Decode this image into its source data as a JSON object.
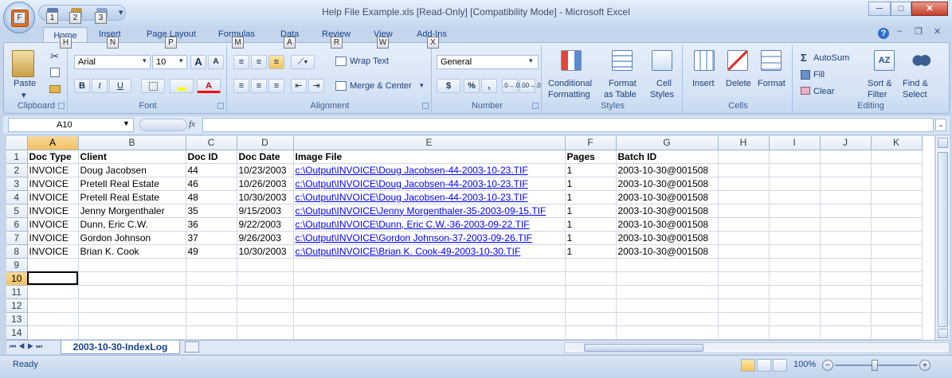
{
  "window": {
    "title": "Help File Example.xls  [Read-Only]  [Compatibility Mode] - Microsoft Excel",
    "office_button_letter": "F",
    "qat_keytips": [
      "1",
      "2",
      "3"
    ],
    "buttons": {
      "minimize": "─",
      "maximize": "□",
      "close": "✕"
    }
  },
  "tabs": [
    {
      "label": "Home",
      "keytip": "H"
    },
    {
      "label": "Insert",
      "keytip": "N"
    },
    {
      "label": "Page Layout",
      "keytip": "P"
    },
    {
      "label": "Formulas",
      "keytip": "M"
    },
    {
      "label": "Data",
      "keytip": "A"
    },
    {
      "label": "Review",
      "keytip": "R"
    },
    {
      "label": "View",
      "keytip": "W"
    },
    {
      "label": "Add-Ins",
      "keytip": "X"
    }
  ],
  "ribbon": {
    "clipboard": {
      "label": "Clipboard",
      "paste": "Paste"
    },
    "font": {
      "label": "Font",
      "name": "Arial",
      "size": "10",
      "bold": "B",
      "italic": "I",
      "underline": "U",
      "grow": "A",
      "shrink": "A",
      "color_letter": "A"
    },
    "alignment": {
      "label": "Alignment",
      "wrap": "Wrap Text",
      "merge": "Merge & Center"
    },
    "number": {
      "label": "Number",
      "format": "General",
      "currency": "$",
      "percent": "%",
      "comma": ",",
      "inc": ".0→.00",
      "dec": ".00→.0"
    },
    "styles": {
      "label": "Styles",
      "conditional_1": "Conditional",
      "conditional_2": "Formatting",
      "format_table_1": "Format",
      "format_table_2": "as Table",
      "cell_styles_1": "Cell",
      "cell_styles_2": "Styles"
    },
    "cells": {
      "label": "Cells",
      "insert": "Insert",
      "delete": "Delete",
      "format": "Format"
    },
    "editing": {
      "label": "Editing",
      "autosum": "AutoSum",
      "fill": "Fill",
      "clear": "Clear",
      "sort_1": "Sort &",
      "sort_2": "Filter",
      "find_1": "Find &",
      "find_2": "Select"
    }
  },
  "formula_bar": {
    "name_box": "A10",
    "fx": "fx",
    "value": ""
  },
  "grid": {
    "columns": [
      "A",
      "B",
      "C",
      "D",
      "E",
      "F",
      "G",
      "H",
      "I",
      "J",
      "K"
    ],
    "rows": [
      [
        "Doc Type",
        "Client",
        "Doc ID",
        "Doc Date",
        "Image File",
        "Pages",
        "Batch ID",
        "",
        "",
        "",
        ""
      ],
      [
        "INVOICE",
        "Doug Jacobsen",
        "44",
        "10/23/2003",
        "c:\\Output\\INVOICE\\Doug Jacobsen-44-2003-10-23.TIF",
        "1",
        "2003-10-30@001508",
        "",
        "",
        "",
        ""
      ],
      [
        "INVOICE",
        "Pretell Real Estate",
        "46",
        "10/26/2003",
        "c:\\Output\\INVOICE\\Doug Jacobsen-44-2003-10-23.TIF",
        "1",
        "2003-10-30@001508",
        "",
        "",
        "",
        ""
      ],
      [
        "INVOICE",
        "Pretell Real Estate",
        "48",
        "10/30/2003",
        "c:\\Output\\INVOICE\\Doug Jacobsen-44-2003-10-23.TIF",
        "1",
        "2003-10-30@001508",
        "",
        "",
        "",
        ""
      ],
      [
        "INVOICE",
        "Jenny Morgenthaler",
        "35",
        "9/15/2003",
        "c:\\Output\\INVOICE\\Jenny Morgenthaler-35-2003-09-15.TIF",
        "1",
        "2003-10-30@001508",
        "",
        "",
        "",
        ""
      ],
      [
        "INVOICE",
        "Dunn, Eric C.W.",
        "36",
        "9/22/2003",
        "c:\\Output\\INVOICE\\Dunn, Eric C.W.-36-2003-09-22.TIF",
        "1",
        "2003-10-30@001508",
        "",
        "",
        "",
        ""
      ],
      [
        "INVOICE",
        "Gordon Johnson",
        "37",
        "9/26/2003",
        "c:\\Output\\INVOICE\\Gordon Johnson-37-2003-09-26.TIF",
        "1",
        "2003-10-30@001508",
        "",
        "",
        "",
        ""
      ],
      [
        "INVOICE",
        "Brian K. Cook",
        "49",
        "10/30/2003",
        "c:\\Output\\INVOICE\\Brian K. Cook-49-2003-10-30.TIF",
        "1",
        "2003-10-30@001508",
        "",
        "",
        "",
        ""
      ],
      [
        "",
        "",
        "",
        "",
        "",
        "",
        "",
        "",
        "",
        "",
        ""
      ],
      [
        "",
        "",
        "",
        "",
        "",
        "",
        "",
        "",
        "",
        "",
        ""
      ],
      [
        "",
        "",
        "",
        "",
        "",
        "",
        "",
        "",
        "",
        "",
        ""
      ],
      [
        "",
        "",
        "",
        "",
        "",
        "",
        "",
        "",
        "",
        "",
        ""
      ],
      [
        "",
        "",
        "",
        "",
        "",
        "",
        "",
        "",
        "",
        "",
        ""
      ],
      [
        "",
        "",
        "",
        "",
        "",
        "",
        "",
        "",
        "",
        "",
        ""
      ]
    ],
    "active_cell": "A10"
  },
  "sheet_tab": "2003-10-30-IndexLog",
  "status": {
    "text": "Ready",
    "zoom": "100%",
    "minus": "−",
    "plus": "+"
  }
}
